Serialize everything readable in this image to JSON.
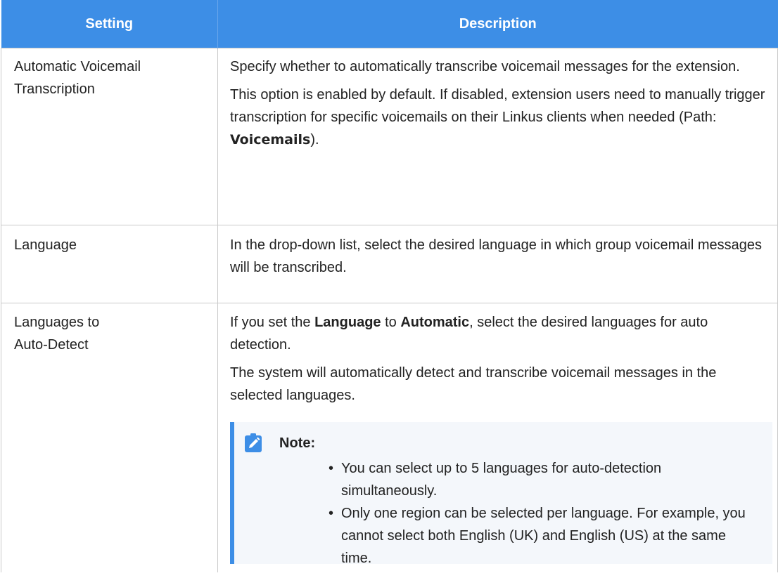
{
  "table": {
    "headers": {
      "setting": "Setting",
      "description": "Description"
    },
    "rows": [
      {
        "setting": "Automatic Voicemail Transcription",
        "p1": "Specify whether to automatically transcribe voicemail messages for the extension.",
        "p2_before": "This option is enabled by default. If disabled, extension users need to manually trigger transcription for specific voicemails on their Linkus clients when needed (Path: ",
        "p2_bold": "Voicemails",
        "p2_after": ")."
      },
      {
        "setting": "Language",
        "p1": "In the drop-down list, select the desired language in which group voicemail messages will be transcribed."
      },
      {
        "setting": "Languages to Auto-Detect",
        "p1_a": "If you set the ",
        "p1_b": "Language",
        "p1_c": " to ",
        "p1_d": "Automatic",
        "p1_e": ", select the desired languages for auto detection.",
        "p2": "The system will automatically detect and transcribe voicemail messages in the selected languages.",
        "note": {
          "icon": "pencil-note-icon",
          "title": "Note:",
          "bullet": "•",
          "items": [
            "You can select up to 5 languages for auto-detection simultaneously.",
            "Only one region can be selected per language. For example, you cannot select both English (UK) and English (US) at the same time."
          ]
        }
      }
    ]
  },
  "colors": {
    "header_bg": "#3d8ee6",
    "header_text": "#ffffff",
    "border": "#c9c9c9",
    "note_bg": "#f4f7fb",
    "note_accent": "#3d8ee6"
  }
}
